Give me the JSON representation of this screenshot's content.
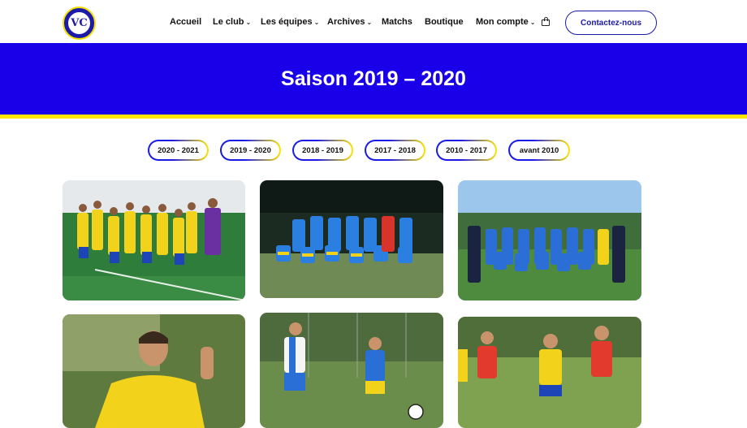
{
  "header": {
    "logo_text": "VC",
    "nav": [
      {
        "label": "Accueil",
        "has_dropdown": false
      },
      {
        "label": "Le club",
        "has_dropdown": true
      },
      {
        "label": "Les équipes",
        "has_dropdown": true
      },
      {
        "label": "Archives",
        "has_dropdown": true
      },
      {
        "label": "Matchs",
        "has_dropdown": false
      },
      {
        "label": "Boutique",
        "has_dropdown": false
      },
      {
        "label": "Mon compte",
        "has_dropdown": true
      }
    ],
    "cart_icon": "shopping-bag-icon",
    "contact_label": "Contactez-nous"
  },
  "banner": {
    "title": "Saison 2019 – 2020"
  },
  "seasons": [
    "2020 - 2021",
    "2019 - 2020",
    "2018 - 2019",
    "2017 - 2018",
    "2010 - 2017",
    "avant 2010"
  ],
  "photos": [
    {
      "name": "team-photo-yellow-kit"
    },
    {
      "name": "team-photo-blue-kit-night"
    },
    {
      "name": "team-photo-blue-kit-staff"
    },
    {
      "name": "player-portrait-yellow-kit"
    },
    {
      "name": "match-action-blue-kit"
    },
    {
      "name": "match-action-yellow-vs-red"
    }
  ],
  "colors": {
    "brand_blue": "#1a00e8",
    "brand_yellow": "#ffe600",
    "button_blue": "#1c1aa8"
  }
}
